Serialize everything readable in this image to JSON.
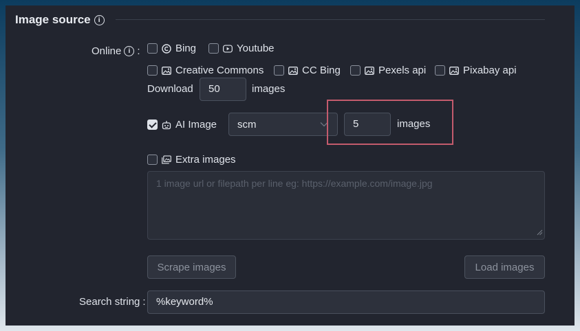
{
  "section": {
    "title": "Image source"
  },
  "online": {
    "label": "Online",
    "colon": ":",
    "sources_row1": [
      {
        "label": "Bing",
        "checked": false,
        "icon": "copyright-icon"
      },
      {
        "label": "Youtube",
        "checked": false,
        "icon": "youtube-icon"
      }
    ],
    "sources_row2": [
      {
        "label": "Creative Commons",
        "checked": false,
        "icon": "image-icon"
      },
      {
        "label": "CC Bing",
        "checked": false,
        "icon": "image-icon"
      },
      {
        "label": "Pexels api",
        "checked": false,
        "icon": "image-icon"
      },
      {
        "label": "Pixabay api",
        "checked": false,
        "icon": "image-icon"
      }
    ]
  },
  "download": {
    "label": "Download",
    "value": "50",
    "suffix": "images"
  },
  "ai_image": {
    "label": "AI Image",
    "checked": true,
    "model": "scm",
    "count": "5",
    "suffix": "images",
    "icon": "robot-icon"
  },
  "extra_images": {
    "label": "Extra images",
    "checked": false,
    "icon": "images-icon",
    "placeholder": "1 image url or filepath per line eg: https://example.com/image.jpg"
  },
  "buttons": {
    "scrape": "Scrape images",
    "load": "Load images"
  },
  "search": {
    "label": "Search string",
    "colon": ":",
    "value": "%keyword%"
  },
  "colors": {
    "panel": "#22252f",
    "highlight": "#c45b6d"
  }
}
